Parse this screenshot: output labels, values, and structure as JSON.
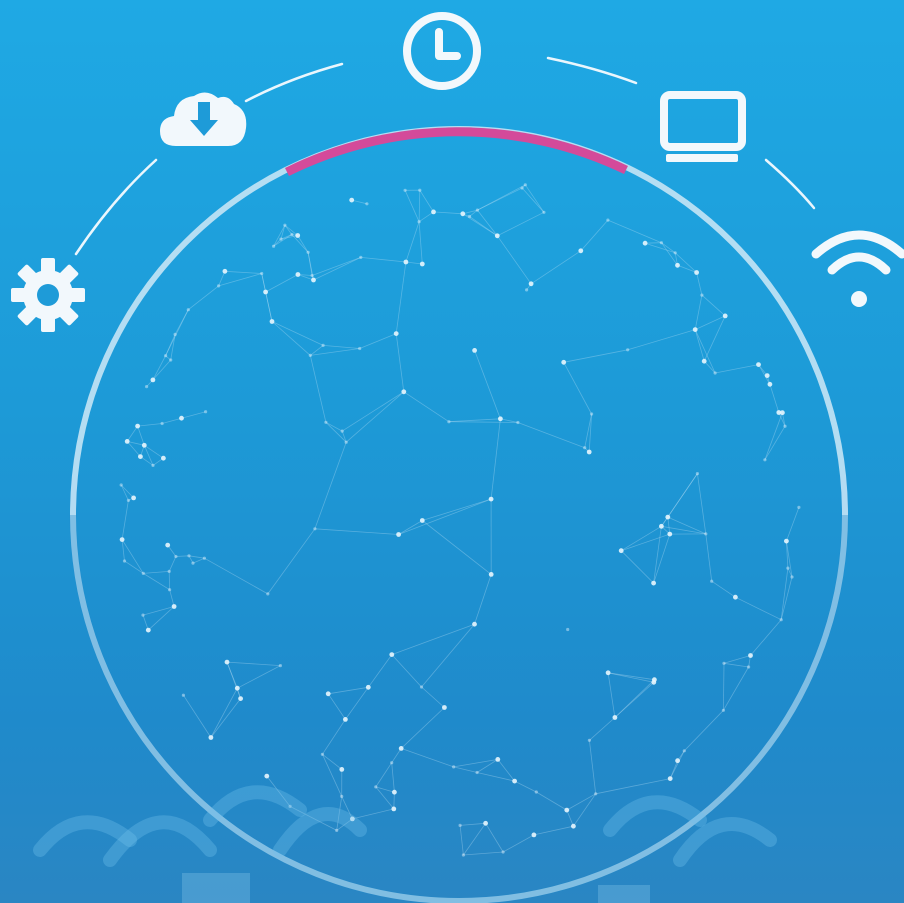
{
  "icons": [
    {
      "name": "gear-icon"
    },
    {
      "name": "cloud-download-icon"
    },
    {
      "name": "clock-icon"
    },
    {
      "name": "monitor-icon"
    },
    {
      "name": "wifi-icon"
    }
  ],
  "colors": {
    "background_top": "#1fa9e4",
    "background_bottom": "#2a86c3",
    "icon": "#f2f8fc",
    "ring": "#cfe9f7",
    "progress_arc": "#d44a9a",
    "network_line": "#bfe3f6",
    "network_dot": "#e6f5fd"
  },
  "progress": {
    "value": 0.25
  }
}
